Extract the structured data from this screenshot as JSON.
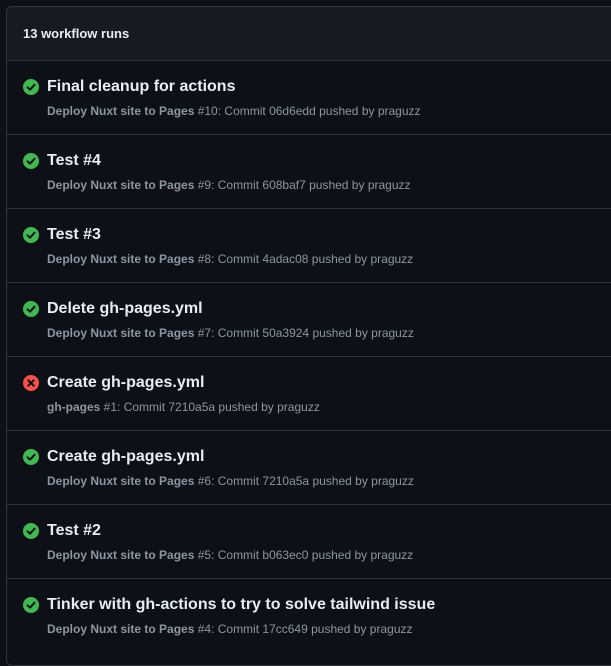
{
  "header": {
    "title": "13 workflow runs"
  },
  "colors": {
    "success": "#3fb950",
    "failure": "#f85149",
    "text": "#e6edf3",
    "muted": "#8d96a0",
    "border": "#30363d",
    "background": "#0d1117",
    "header_background": "#161b22"
  },
  "runs": [
    {
      "status": "success",
      "status_icon": "check-circle-icon",
      "title": "Final cleanup for actions",
      "workflow": "Deploy Nuxt site to Pages",
      "detail": " #10: Commit 06d6edd pushed by praguzz"
    },
    {
      "status": "success",
      "status_icon": "check-circle-icon",
      "title": "Test #4",
      "workflow": "Deploy Nuxt site to Pages",
      "detail": " #9: Commit 608baf7 pushed by praguzz"
    },
    {
      "status": "success",
      "status_icon": "check-circle-icon",
      "title": "Test #3",
      "workflow": "Deploy Nuxt site to Pages",
      "detail": " #8: Commit 4adac08 pushed by praguzz"
    },
    {
      "status": "success",
      "status_icon": "check-circle-icon",
      "title": "Delete gh-pages.yml",
      "workflow": "Deploy Nuxt site to Pages",
      "detail": " #7: Commit 50a3924 pushed by praguzz"
    },
    {
      "status": "failure",
      "status_icon": "x-circle-icon",
      "title": "Create gh-pages.yml",
      "workflow": "gh-pages",
      "detail": " #1: Commit 7210a5a pushed by praguzz"
    },
    {
      "status": "success",
      "status_icon": "check-circle-icon",
      "title": "Create gh-pages.yml",
      "workflow": "Deploy Nuxt site to Pages",
      "detail": " #6: Commit 7210a5a pushed by praguzz"
    },
    {
      "status": "success",
      "status_icon": "check-circle-icon",
      "title": "Test #2",
      "workflow": "Deploy Nuxt site to Pages",
      "detail": " #5: Commit b063ec0 pushed by praguzz"
    },
    {
      "status": "success",
      "status_icon": "check-circle-icon",
      "title": "Tinker with gh-actions to try to solve tailwind issue",
      "workflow": "Deploy Nuxt site to Pages",
      "detail": " #4: Commit 17cc649 pushed by praguzz"
    }
  ]
}
